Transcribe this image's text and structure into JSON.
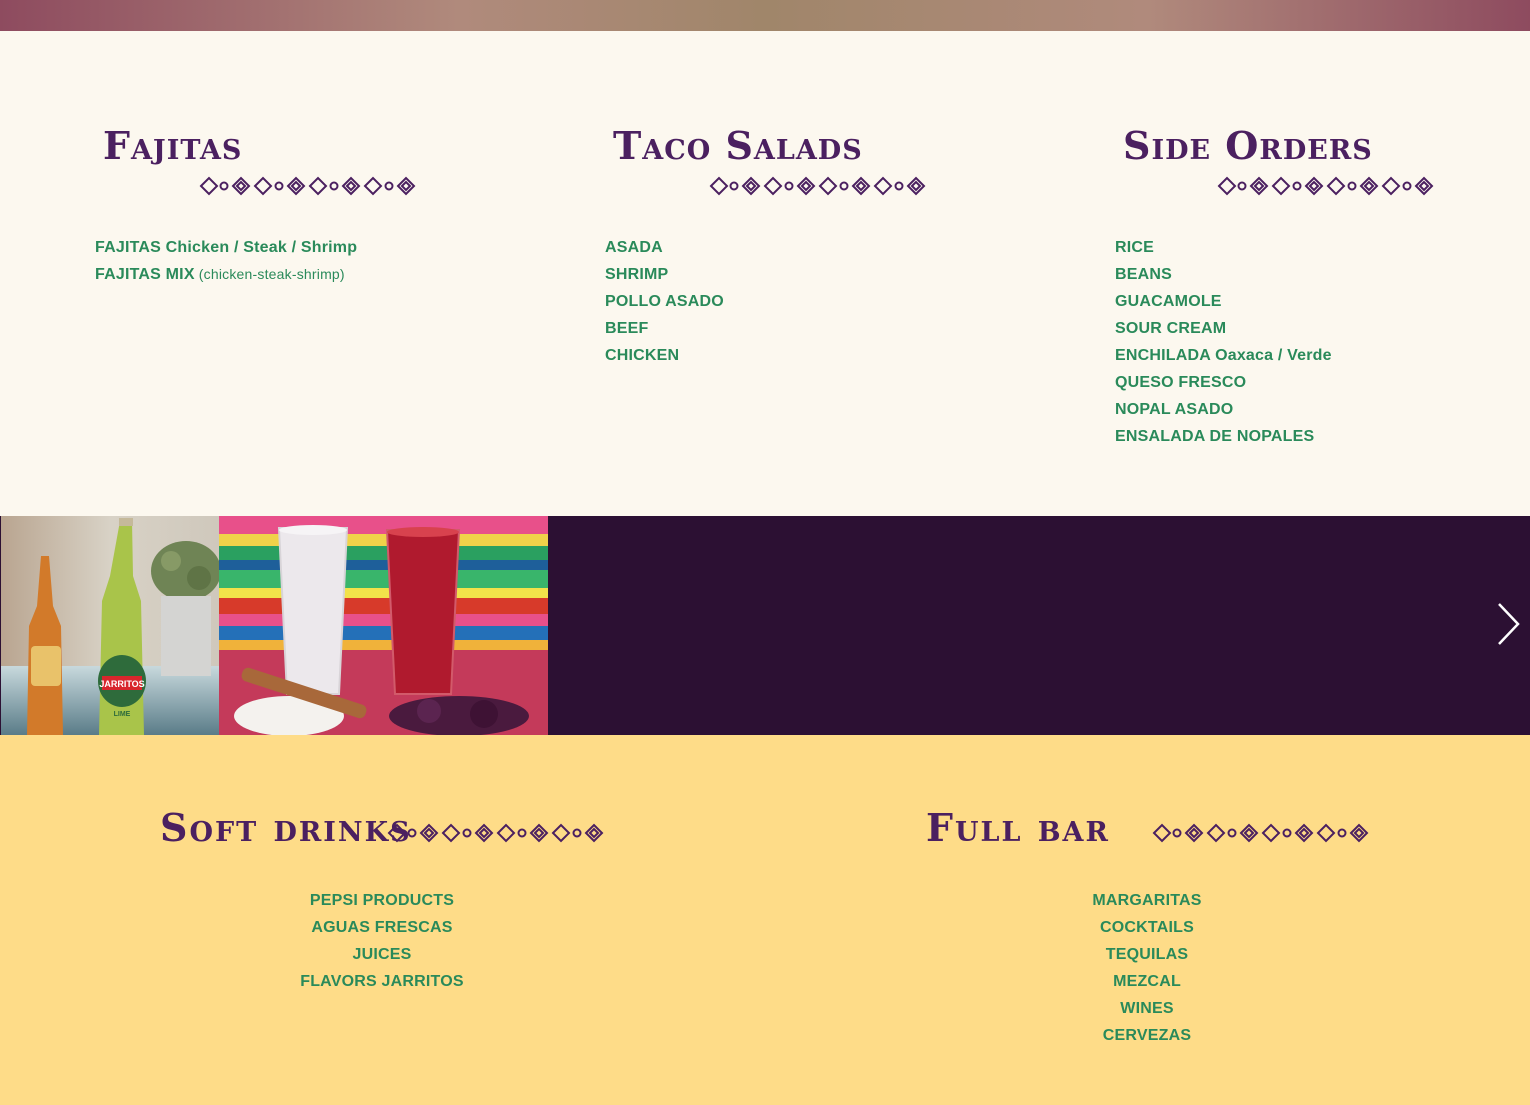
{
  "sections": {
    "fajitas": {
      "title": "Fajitas",
      "items": [
        {
          "name": "FAJITAS",
          "detail": " Chicken / Steak / Shrimp",
          "note": ""
        },
        {
          "name": "FAJITAS MIX",
          "detail": "",
          "note": " (chicken-steak-shrimp)"
        }
      ]
    },
    "taco_salads": {
      "title": "Taco Salads",
      "items": [
        "ASADA",
        "SHRIMP",
        "POLLO ASADO",
        "BEEF",
        "CHICKEN"
      ]
    },
    "side_orders": {
      "title": "Side Orders",
      "items": [
        {
          "name": "RICE",
          "detail": ""
        },
        {
          "name": "BEANS",
          "detail": ""
        },
        {
          "name": "GUACAMOLE",
          "detail": ""
        },
        {
          "name": "SOUR CREAM",
          "detail": ""
        },
        {
          "name": "ENCHILADA",
          "detail": " Oaxaca / Verde"
        },
        {
          "name": "QUESO FRESCO",
          "detail": ""
        },
        {
          "name": "NOPAL ASADO",
          "detail": ""
        },
        {
          "name": "ENSALADA DE NOPALES",
          "detail": ""
        }
      ]
    }
  },
  "drinks": {
    "soft": {
      "title": "Soft drinks",
      "items": [
        "PEPSI PRODUCTS",
        "AGUAS FRESCAS",
        "JUICES",
        "FLAVORS JARRITOS"
      ]
    },
    "bar": {
      "title": "Full bar",
      "items": [
        "MARGARITAS",
        "COCKTAILS",
        "TEQUILAS",
        "MEZCAL",
        "WINES",
        "CERVEZAS"
      ]
    }
  },
  "gallery": {
    "photo1_label": "JARRITOS",
    "photo1_sub": "LIME",
    "next_icon": "chevron-right-icon"
  },
  "colors": {
    "title": "#4b2060",
    "item": "#2a8a5a",
    "menu_bg": "#fcf8ef",
    "gallery_bg": "#2c1033",
    "drinks_bg": "#fedc88"
  }
}
